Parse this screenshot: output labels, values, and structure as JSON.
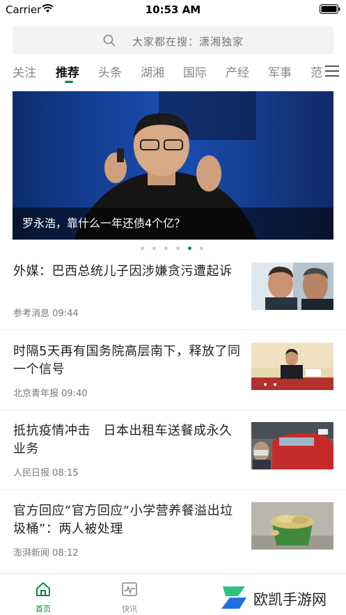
{
  "status": {
    "carrier": "Carrier",
    "time": "10:53 AM"
  },
  "search": {
    "placeholder": "大家都在搜：潇湘独家"
  },
  "tabs": [
    {
      "label": "关注"
    },
    {
      "label": "推荐"
    },
    {
      "label": "头条"
    },
    {
      "label": "湖湘"
    },
    {
      "label": "国际"
    },
    {
      "label": "产经"
    },
    {
      "label": "军事"
    },
    {
      "label": "范"
    }
  ],
  "active_tab": "推荐",
  "banner": {
    "caption": "罗永浩，靠什么一年还债4个亿？",
    "slide_index": 5,
    "slide_count": 6
  },
  "news": [
    {
      "title": "外媒：巴西总统儿子因涉嫌贪污遭起诉",
      "source": "参考消息",
      "time": "09:44",
      "thumb_icon": "portrait-photo"
    },
    {
      "title": "时隔5天再有国务院高层南下，释放了同一个信号",
      "source": "北京青年报",
      "time": "09:40",
      "thumb_icon": "meeting-photo"
    },
    {
      "title": "抵抗疫情冲击　日本出租车送餐成永久业务",
      "source": "人民日报",
      "time": "08:15",
      "thumb_icon": "taxi-photo"
    },
    {
      "title": "官方回应“官方回应“小学营养餐溢出垃圾桶”：两人被处理",
      "source": "澎湃新闻",
      "time": "08:12",
      "thumb_icon": "bucket-photo"
    }
  ],
  "tabbar": [
    {
      "label": "首页",
      "icon": "home-icon"
    },
    {
      "label": "快讯",
      "icon": "pulse-icon"
    }
  ],
  "watermark": {
    "text": "欧凯手游网"
  },
  "colors": {
    "accent": "#0a8a3c",
    "text": "#222222",
    "meta": "#777777"
  }
}
